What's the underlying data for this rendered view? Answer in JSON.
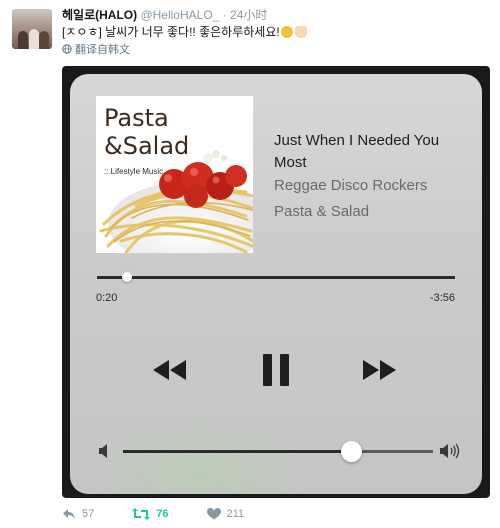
{
  "tweet": {
    "display_name": "헤일로(HALO)",
    "handle": "@HelloHALO_",
    "separator": "·",
    "time": "24小时",
    "text": "[ㅈㅇㅎ] 날씨가 너무 좋다!! 좋은하루하세요!",
    "translate_label": "翻译自韩文",
    "colors": {
      "link": "#1da1f2",
      "secondary": "#8899a6",
      "retweet_active": "#19cf86"
    }
  },
  "player": {
    "album_art": {
      "title_line1": "Pasta",
      "title_line2": "&Salad",
      "subtitle": ":: Lifestyle Music"
    },
    "track_title": "Just When I Needed You Most",
    "artist": "Reggae Disco Rockers",
    "album": "Pasta & Salad",
    "elapsed": "0:20",
    "remaining": "-3:56",
    "progress_fraction": 0.085,
    "volume_fraction": 0.735,
    "icons": {
      "rewind": "rewind-icon",
      "pause": "pause-icon",
      "forward": "fast-forward-icon",
      "volume_low": "volume-low-icon",
      "volume_high": "volume-high-icon"
    }
  },
  "actions": {
    "reply_count": "57",
    "retweet_count": "76",
    "like_count": "211"
  }
}
